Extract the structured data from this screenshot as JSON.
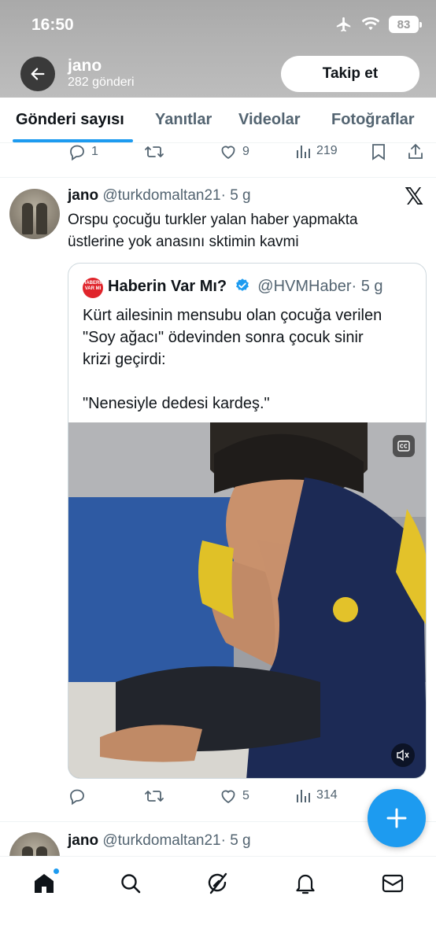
{
  "status_bar": {
    "time": "16:50",
    "battery": "83"
  },
  "header": {
    "name": "jano",
    "post_count": "282 gönderi",
    "follow_label": "Takip et"
  },
  "tabs": [
    {
      "label": "Gönderi sayısı",
      "active": true
    },
    {
      "label": "Yanıtlar",
      "active": false
    },
    {
      "label": "Videolar",
      "active": false
    },
    {
      "label": "Fotoğraflar",
      "active": false
    }
  ],
  "prev_tweet_actions": {
    "replies": "1",
    "retweets": "",
    "likes": "9",
    "views": "219"
  },
  "tweet": {
    "name": "jano",
    "handle": "@turkdomaltan21",
    "time": "· 5 g",
    "text_line1": "Orspu çocuğu turkler yalan haber yapmakta",
    "text_line2": "üstlerine yok anasını sktimin kavmi",
    "quote": {
      "avatar_text": "HABERIN VAR MI",
      "name": "Haberin Var Mı?",
      "handle": "@HVMHaber",
      "time": "· 5 g",
      "text_line1": "Kürt ailesinin mensubu olan çocuğa verilen",
      "text_line2": "\"Soy ağacı\" ödevinden sonra çocuk sinir",
      "text_line3": "krizi geçirdi:",
      "text_line4": "\"Nenesiyle dedesi kardeş.\""
    },
    "actions": {
      "replies": "",
      "retweets": "",
      "likes": "5",
      "views": "314"
    }
  },
  "next_tweet": {
    "name": "jano",
    "handle": "@turkdomaltan21",
    "time": "· 5 g"
  },
  "icons": {
    "back": "arrow-left-icon",
    "airplane": "airplane-icon",
    "wifi": "wifi-icon",
    "reply": "reply-icon",
    "retweet": "retweet-icon",
    "like": "heart-icon",
    "views": "bar-chart-icon",
    "bookmark": "bookmark-icon",
    "share": "share-icon",
    "x_logo": "x-logo-icon",
    "home": "home-icon",
    "search": "search-icon",
    "grok": "grok-icon",
    "notifications": "bell-icon",
    "messages": "mail-icon",
    "compose": "plus-icon"
  },
  "colors": {
    "accent": "#1d9bf0",
    "text_primary": "#0f1419",
    "text_secondary": "#536471",
    "quote_avatar": "#e0242b"
  }
}
